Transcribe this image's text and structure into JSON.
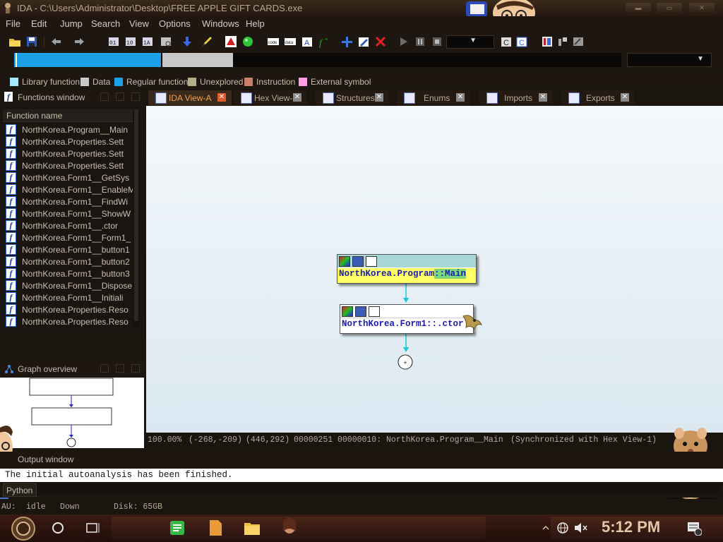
{
  "window": {
    "title": "IDA - C:\\Users\\Administrator\\Desktop\\FREE APPLE GIFT CARDS.exe"
  },
  "menu": [
    "File",
    "Edit",
    "Jump",
    "Search",
    "View",
    "Options",
    "Windows",
    "Help"
  ],
  "legend": [
    {
      "label": "Library function",
      "color": "#a8e8ff"
    },
    {
      "label": "Data",
      "color": "#c8c8c8"
    },
    {
      "label": "Regular function",
      "color": "#1ca0ea"
    },
    {
      "label": "Unexplored",
      "color": "#b7ad8a"
    },
    {
      "label": "Instruction",
      "color": "#c8806a"
    },
    {
      "label": "External symbol",
      "color": "#ff9ee6"
    }
  ],
  "functions_window": {
    "title": "Functions window",
    "column": "Function name",
    "items": [
      "NorthKorea.Program__Main",
      "NorthKorea.Properties.Sett",
      "NorthKorea.Properties.Sett",
      "NorthKorea.Properties.Sett",
      "NorthKorea.Form1__GetSys",
      "NorthKorea.Form1__EnableM",
      "NorthKorea.Form1__FindWi",
      "NorthKorea.Form1__ShowW",
      "NorthKorea.Form1__.ctor",
      "NorthKorea.Form1__Form1_",
      "NorthKorea.Form1__button1",
      "NorthKorea.Form1__button2",
      "NorthKorea.Form1__button3",
      "NorthKorea.Form1__Dispose",
      "NorthKorea.Form1__Initiali",
      "NorthKorea.Properties.Reso",
      "NorthKorea.Properties.Reso"
    ]
  },
  "tabs": [
    {
      "label": "IDA View-A",
      "active": true
    },
    {
      "label": "Hex View-1"
    },
    {
      "label": "Structures"
    },
    {
      "label": "Enums"
    },
    {
      "label": "Imports"
    },
    {
      "label": "Exports"
    }
  ],
  "graph": {
    "node1_prefix": "NorthKorea.Program",
    "node1_suffix": "::Main",
    "node2_label": "NorthKorea.Form1::.ctor"
  },
  "status": {
    "zoom": "100.00%",
    "coords1": "(-268,-209)",
    "coords2": "(446,292)",
    "addr": "00000251",
    "location": "00000010: NorthKorea.Program__Main",
    "sync": "(Synchronized with Hex View-1)"
  },
  "graph_overview": {
    "title": "Graph overview"
  },
  "output": {
    "title": "Output window",
    "message": "The initial autoanalysis has been finished.",
    "interpreter": "Python"
  },
  "bottom_status": {
    "au_label": "AU:",
    "au_state": "idle",
    "direction": "Down",
    "disk": "Disk: 65GB"
  },
  "taskbar": {
    "time": "5:12 PM"
  }
}
